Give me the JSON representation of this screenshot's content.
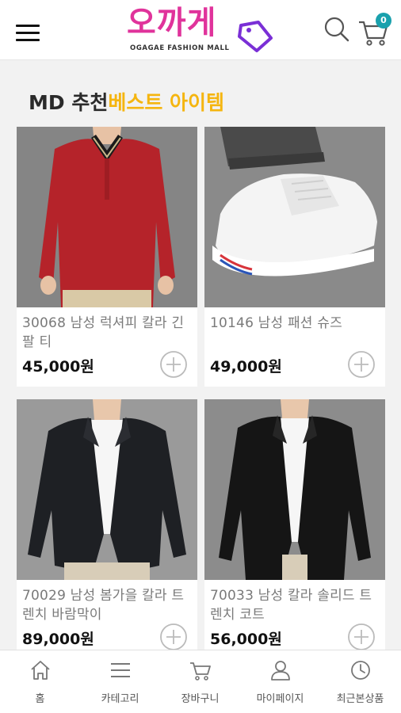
{
  "header": {
    "logo_main": "오까게",
    "logo_sub": "OGAGAE FASHION MALL",
    "cart_count": "0",
    "brand_color": "#e0339b",
    "badge_color": "#1aa1ad"
  },
  "section": {
    "title_prefix": "MD 추천",
    "title_highlight": "베스트 아이템",
    "highlight_color": "#f5b50f"
  },
  "products": [
    {
      "name": "30068 남성 럭셔피 칼라 긴팔 티",
      "price": "45,000원",
      "image": "red-polo-shirt"
    },
    {
      "name": "10146 남성 패션 슈즈",
      "price": "49,000원",
      "image": "white-sneakers"
    },
    {
      "name": "70029 남성 봄가을 칼라 트렌치 바람막이",
      "price": "89,000원",
      "image": "black-trench-jacket"
    },
    {
      "name": "70033 남성 칼라 솔리드 트렌치 코트",
      "price": "56,000원",
      "image": "black-shirt-jacket"
    }
  ],
  "bottom_nav": [
    {
      "label": "홈",
      "icon": "home-icon"
    },
    {
      "label": "카테고리",
      "icon": "list-icon"
    },
    {
      "label": "장바구니",
      "icon": "cart-icon"
    },
    {
      "label": "마이페이지",
      "icon": "user-icon"
    },
    {
      "label": "최근본상품",
      "icon": "clock-icon"
    }
  ]
}
